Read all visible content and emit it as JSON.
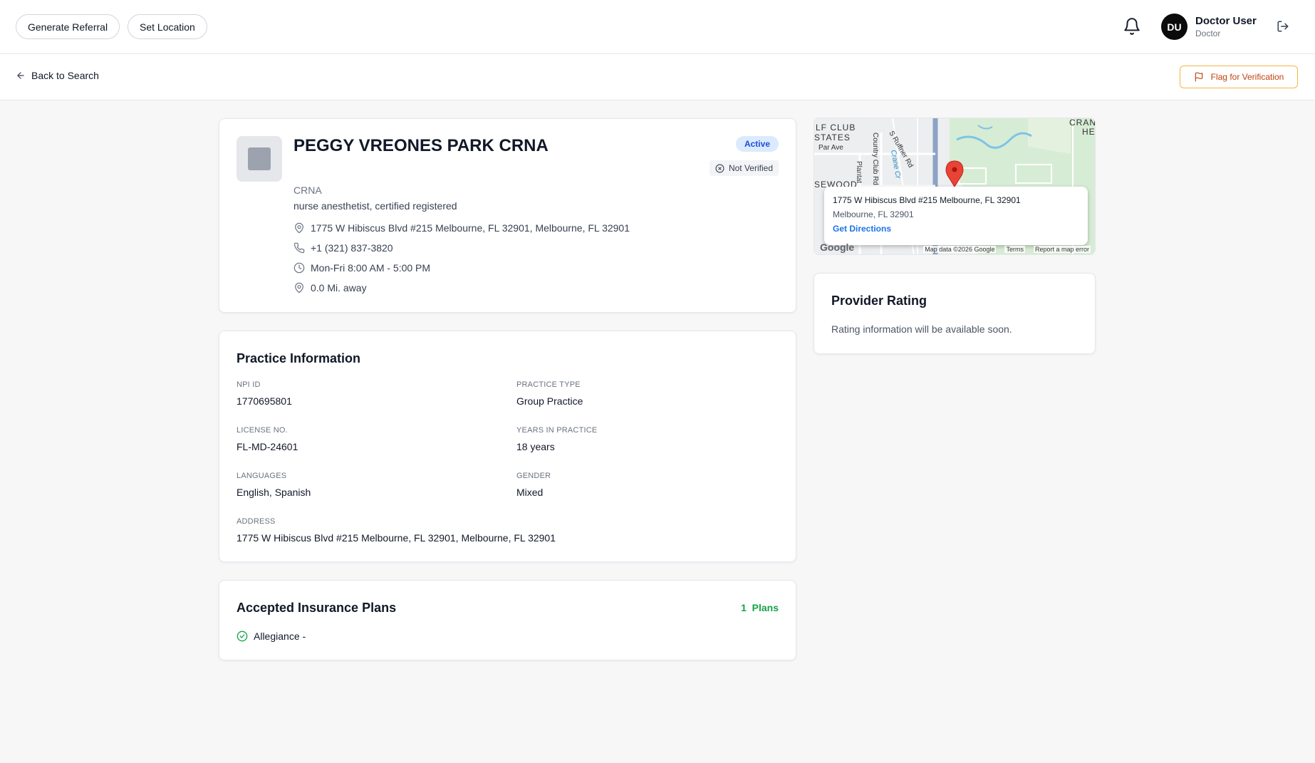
{
  "header": {
    "generate_referral": "Generate Referral",
    "set_location": "Set Location",
    "user_initials": "DU",
    "user_name": "Doctor User",
    "user_role": "Doctor"
  },
  "subheader": {
    "back_label": "Back to Search",
    "flag_label": "Flag for Verification"
  },
  "provider": {
    "name": "PEGGY VREONES PARK CRNA",
    "credential": "CRNA",
    "specialty": "nurse anesthetist, certified registered",
    "address": "1775 W Hibiscus Blvd #215 Melbourne, FL 32901, Melbourne, FL 32901",
    "phone": "+1 (321) 837-3820",
    "hours": "Mon-Fri 8:00 AM - 5:00 PM",
    "distance": "0.0 Mi. away",
    "status": "Active",
    "verification": "Not Verified"
  },
  "practice": {
    "title": "Practice Information",
    "npi_label": "NPI ID",
    "npi_value": "1770695801",
    "type_label": "PRACTICE TYPE",
    "type_value": "Group Practice",
    "license_label": "LICENSE NO.",
    "license_value": "FL-MD-24601",
    "years_label": "YEARS IN PRACTICE",
    "years_value": "18 years",
    "languages_label": "LANGUAGES",
    "languages_value": "English, Spanish",
    "gender_label": "GENDER",
    "gender_value": "Mixed",
    "address_label": "ADDRESS",
    "address_value": "1775 W Hibiscus Blvd #215 Melbourne, FL 32901, Melbourne, FL 32901"
  },
  "insurance": {
    "title": "Accepted Insurance Plans",
    "count": "1",
    "count_suffix": "Plans",
    "plans": [
      "Allegiance -"
    ]
  },
  "map": {
    "popup_address": "1775 W Hibiscus Blvd #215 Melbourne, FL 32901",
    "popup_city": "Melbourne, FL 32901",
    "popup_link": "Get Directions",
    "labels": {
      "golf_club": "LF CLUB",
      "estates": "STATES",
      "par_ave": "Par Ave",
      "country_club": "Country Club Rd",
      "ruffner": "S Ruffner Rd",
      "crane": "Crane Cr",
      "sewood": "SEWOOD",
      "plantation": "Plantat",
      "cran": "CRAN",
      "he": "HE"
    },
    "google": "Google",
    "footer_data": "Map data ©2026 Google",
    "footer_terms": "Terms",
    "footer_report": "Report a map error"
  },
  "rating": {
    "title": "Provider Rating",
    "text": "Rating information will be available soon."
  },
  "colors": {
    "active_badge": "#dbeafe",
    "plans_green": "#16a34a",
    "flag_orange": "#c2410c"
  }
}
